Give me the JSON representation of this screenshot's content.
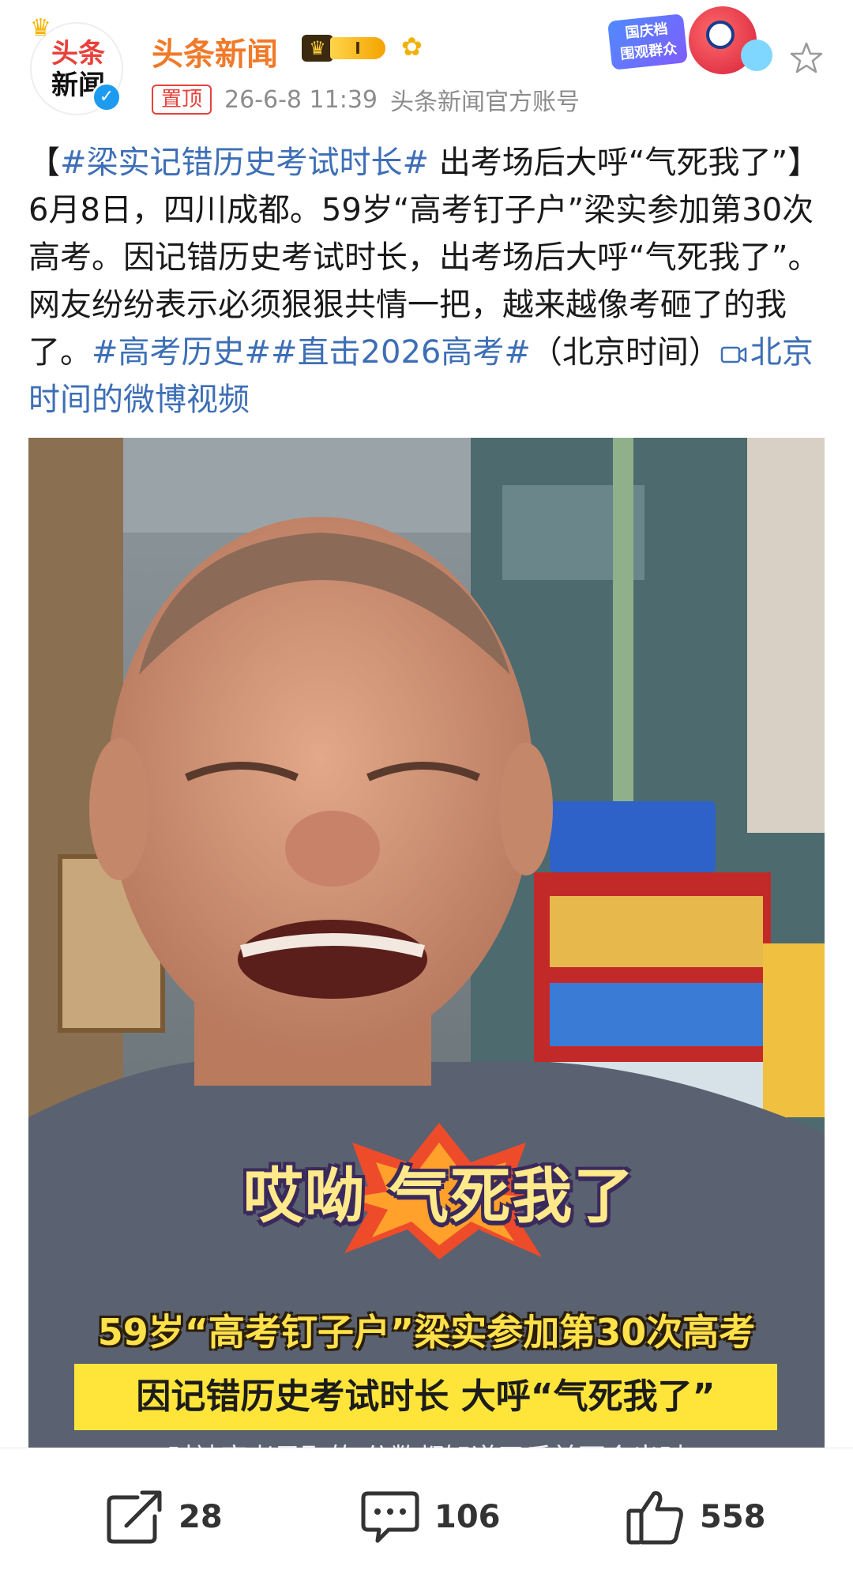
{
  "header": {
    "avatar_text_line1": "头条",
    "avatar_text_line2": "新闻",
    "name": "头条新闻",
    "vip_level": "I",
    "pin_label": "置顶",
    "time": "26-6-8 11:39",
    "source": "头条新闻官方账号",
    "event_badge_text_line1": "国庆档",
    "event_badge_text_line2": "围观群众"
  },
  "post": {
    "prefix": "【",
    "tag1": "#梁实记错历史考试时长#",
    "title_rest": " 出考场后大呼“气死我了”】",
    "body": "6月8日，四川成都。59岁“高考钉子户”梁实参加第30次高考。因记错历史考试时长，出考场后大呼“气死我了”。网友纷纷表示必须狠狠共情一把，越来越像考砸了的我了。",
    "tag2": "#高考历史#",
    "tag3": "#直击2026高考#",
    "suffix": "（北京时间）",
    "video_link": "北京时间的微博视频"
  },
  "media": {
    "sticker_text": "哎呦 气死我了",
    "caption1": "59岁“高考钉子户”梁实参加第30次高考",
    "caption2": "因记错历史考试时长 大呼“气死我了”",
    "caption3": "时被高考录取的 分数都知道了后前面会出时"
  },
  "actions": {
    "share_count": "28",
    "comment_count": "106",
    "like_count": "558"
  },
  "colors": {
    "accent_name": "#f07a2a",
    "link": "#3e6fb6",
    "pin": "#e8413b",
    "caption_bg": "#ffe53a"
  }
}
